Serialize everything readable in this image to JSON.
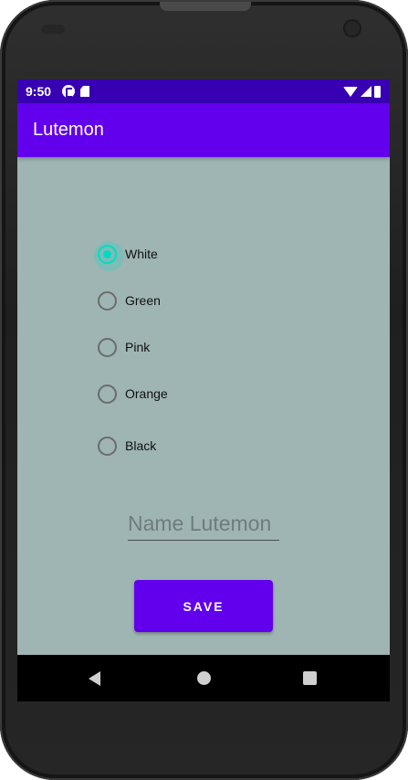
{
  "status_bar": {
    "time": "9:50",
    "icons": [
      "app-notification-icon",
      "sd-card-icon",
      "wifi-icon",
      "signal-icon",
      "battery-icon"
    ]
  },
  "app_bar": {
    "title": "Lutemon"
  },
  "colors": {
    "primary": "#6200ee",
    "primary_dark": "#3700b3",
    "accent": "#03dac5",
    "background": "#9fb5b3"
  },
  "radio_group": {
    "selected": "White",
    "options": [
      {
        "label": "White",
        "checked": true
      },
      {
        "label": "Green",
        "checked": false
      },
      {
        "label": "Pink",
        "checked": false
      },
      {
        "label": "Orange",
        "checked": false
      },
      {
        "label": "Black",
        "checked": false
      }
    ]
  },
  "name_input": {
    "value": "",
    "placeholder": "Name Lutemon"
  },
  "save_button": {
    "label": "SAVE"
  },
  "nav_bar": {
    "icons": [
      "back-icon",
      "home-icon",
      "recents-icon"
    ]
  }
}
